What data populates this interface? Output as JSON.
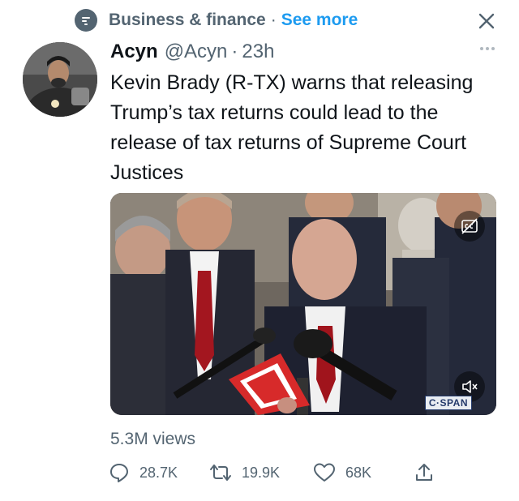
{
  "context": {
    "topic": "Business & finance",
    "separator": "·",
    "see_more": "See more"
  },
  "author": {
    "name": "Acyn",
    "handle": "@Acyn",
    "separator": "·",
    "time": "23h"
  },
  "tweet": {
    "text": "Kevin Brady (R-TX) warns that releasing Trump’s tax returns could lead to the release of tax returns of Supreme Court Justices"
  },
  "media": {
    "watermark": "C·SPAN"
  },
  "stats": {
    "views": "5.3M views"
  },
  "actions": {
    "replies": "28.7K",
    "retweets": "19.9K",
    "likes": "68K"
  },
  "colors": {
    "accent": "#1d9bf0",
    "secondary_text": "#536471",
    "primary_text": "#0f1419"
  },
  "icons": [
    "topic-icon",
    "close-icon",
    "more-icon",
    "captions-icon",
    "mute-icon",
    "reply-icon",
    "retweet-icon",
    "like-icon",
    "share-icon"
  ]
}
